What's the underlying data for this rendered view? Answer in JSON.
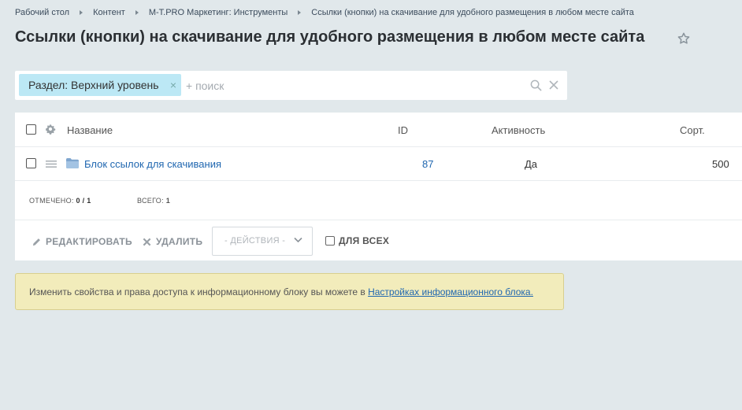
{
  "breadcrumb": [
    "Рабочий стол",
    "Контент",
    "M-T.PRO Маркетинг: Инструменты",
    "Ссылки (кнопки) на скачивание для удобного размещения в любом месте сайта"
  ],
  "page_title": "Ссылки (кнопки) на скачивание для удобного размещения в любом месте сайта",
  "filter": {
    "tag_label": "Раздел: Верхний уровень",
    "tag_close": "×",
    "search_placeholder": "+ поиск"
  },
  "grid": {
    "columns": {
      "name": "Название",
      "id": "ID",
      "active": "Активность",
      "sort": "Сорт."
    },
    "rows": [
      {
        "name": "Блок ссылок для скачивания",
        "id": "87",
        "active": "Да",
        "sort": "500"
      }
    ],
    "counters": {
      "selected_label": "ОТМЕЧЕНО:",
      "selected_value": "0 / 1",
      "total_label": "ВСЕГО:",
      "total_value": "1"
    }
  },
  "actions": {
    "edit": "РЕДАКТИРОВАТЬ",
    "delete": "УДАЛИТЬ",
    "select": "- ДЕЙСТВИЯ -",
    "for_all": "ДЛЯ ВСЕХ"
  },
  "notice": {
    "text": "Изменить свойства и права доступа к информационному блоку вы можете в ",
    "link": "Настройках информационного блока."
  },
  "colors": {
    "background": "#e1e8eb",
    "link": "#2067b0",
    "filter_tag": "#bce8f5",
    "notice_bg": "#f2ecbb"
  }
}
